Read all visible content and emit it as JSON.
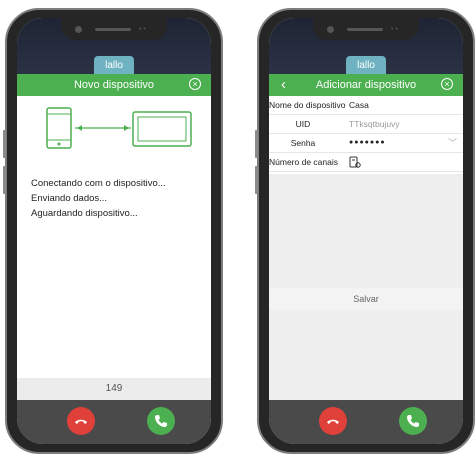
{
  "left_screen": {
    "brand_text": "lallo",
    "header_title": "Novo dispositivo",
    "status_lines": [
      "Conectando com o dispositivo...",
      "Enviando dados...",
      "Aguardando dispositivo..."
    ],
    "counter": "149"
  },
  "right_screen": {
    "brand_text": "lallo",
    "header_title": "Adicionar dispositivo",
    "fields": [
      {
        "label": "Nome do dispositivo",
        "value": "Casa"
      },
      {
        "label": "UID",
        "value": "TTksqtbujuvy"
      },
      {
        "label": "Senha",
        "value": "●●●●●●●"
      },
      {
        "label": "Número de canais",
        "value": ""
      }
    ],
    "save_label": "Salvar"
  },
  "colors": {
    "header": "#4caf50",
    "reject": "#e0403a",
    "accept": "#4caf50"
  },
  "icons": [
    "close-circle-icon",
    "back-chevron-icon",
    "phone-icon",
    "tablet-icon",
    "channel-icon",
    "hangup-icon",
    "answer-icon",
    "chevron-down-icon"
  ]
}
